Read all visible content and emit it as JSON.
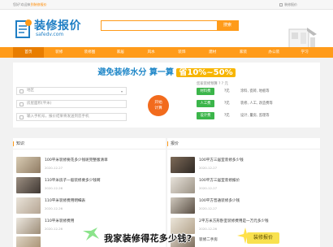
{
  "topbar": {
    "welcome_prefix": "您好!欢迎来",
    "welcome_link": "到装修报价",
    "site_link": "装修报价"
  },
  "logo": {
    "title": "装修报价",
    "subtitle": "safedv.com"
  },
  "search": {
    "placeholder": "",
    "button": "搜索"
  },
  "nav": {
    "items": [
      {
        "label": "首页",
        "active": true
      },
      {
        "label": "装修"
      },
      {
        "label": "装修图"
      },
      {
        "label": "家居"
      },
      {
        "label": "风水"
      },
      {
        "label": "装饰"
      },
      {
        "label": "建材"
      },
      {
        "label": "家装"
      },
      {
        "label": "办公装"
      },
      {
        "label": "学习"
      }
    ]
  },
  "quote": {
    "title_prefix": "避免装修水分 算一算",
    "title_highlight": "省10%~50%",
    "fields": [
      {
        "placeholder": "地区"
      },
      {
        "placeholder": "房屋面积(平米)"
      },
      {
        "placeholder": "输入手机号，报价结果将发送到您手机"
      }
    ],
    "calc_button_line1": "开始",
    "calc_button_line2": "计算",
    "result_header": "您家装修预算 ? ? 元",
    "results": [
      {
        "tag": "材料费",
        "amount": "?元",
        "desc": "涂料, 瓷砖, 地板等"
      },
      {
        "tag": "人工费",
        "amount": "?元",
        "desc": "装修, 人工, 改造费等"
      },
      {
        "tag": "设计费",
        "amount": "?元",
        "desc": "设计, 量房, 监理等"
      }
    ]
  },
  "left_panel": {
    "header": "知识",
    "items": [
      {
        "title": "100平米装修要花多少钱呢完整版清单",
        "date": "2020-12-27"
      },
      {
        "title": "110平米房子一般装修要多少钱啊",
        "date": "2020-12-26"
      },
      {
        "title": "110平米装修费用明细表",
        "date": "2020-12-26"
      },
      {
        "title": "110平米装修费用",
        "date": "2020-12-26"
      },
      {
        "title": "",
        "date": ""
      }
    ]
  },
  "right_panel": {
    "header": "报价",
    "items": [
      {
        "title": "100平方三居室装修多少钱",
        "date": "2020-12-27"
      },
      {
        "title": "100平方三居室装修报价",
        "date": "2020-12-27"
      },
      {
        "title": "100平方普通装修多少钱",
        "date": "2020-12-27"
      },
      {
        "title": "2平方米方形卧室装修费用是一万元多少钱",
        "date": "2020-12-26"
      },
      {
        "title": "装修二手房",
        "date": ""
      }
    ]
  },
  "overlay": {
    "caption": "我家装修得花多少钱?",
    "badge": "装修报价"
  }
}
